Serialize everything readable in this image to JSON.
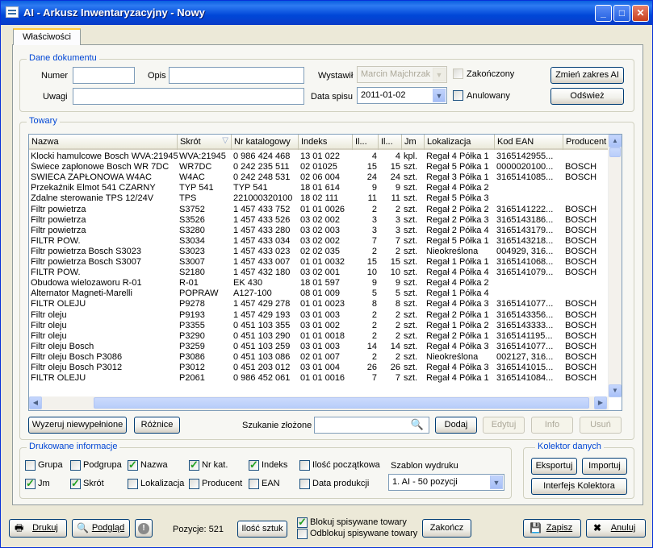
{
  "window": {
    "title": "AI - Arkusz Inwentaryzacyjny - Nowy",
    "min": "_",
    "max": "□",
    "close": "✕"
  },
  "tab": {
    "label": "Właściwości"
  },
  "doc": {
    "legend": "Dane dokumentu",
    "numer_label": "Numer",
    "numer_value": "",
    "opis_label": "Opis",
    "opis_value": "",
    "uwagi_label": "Uwagi",
    "uwagi_value": "",
    "wystawil_label": "Wystawił",
    "wystawil_value": "Marcin Majchrzak",
    "data_label": "Data spisu",
    "data_value": "2011-01-02",
    "zakonczony_label": "Zakończony",
    "anulowany_label": "Anulowany",
    "zmien_label": "Zmień zakres AI",
    "odswiez_label": "Odśwież"
  },
  "towary": {
    "legend": "Towary",
    "columns": [
      "Nazwa",
      "Skrót",
      "Nr katalogowy",
      "Indeks",
      "Il...",
      "Il...",
      "Jm",
      "Lokalizacja",
      "Kod EAN",
      "Producent"
    ],
    "rows": [
      [
        "Klocki hamulcowe Bosch WVA:21945",
        "WVA:21945",
        "0 986 424 468",
        "13 01 022",
        "4",
        "4",
        "kpl.",
        "Regał 4 Półka 1",
        "3165142955...",
        ""
      ],
      [
        "Świece zapłonowe Bosch WR 7DC",
        "WR7DC",
        "0 242 235 511",
        "02 01025",
        "15",
        "15",
        "szt.",
        "Regał 5 Półka 1",
        "0000020100...",
        "BOSCH"
      ],
      [
        "SWIECA ZAPŁONOWA  W4AC",
        "W4AC",
        "0 242 248 531",
        "02 06 004",
        "24",
        "24",
        "szt.",
        "Regał 3 Półka 1",
        "3165141085...",
        "BOSCH"
      ],
      [
        "Przekaźnik Elmot 541 CZARNY",
        "TYP 541",
        "TYP 541",
        "18 01 614",
        "9",
        "9",
        "szt.",
        "Regał 4 Półka 2",
        "",
        ""
      ],
      [
        "Zdalne sterowanie TPS 12/24V",
        "TPS",
        "221000320100",
        "18 02 111",
        "11",
        "11",
        "szt.",
        "Regał 5 Półka 3",
        "",
        ""
      ],
      [
        "Filtr powietrza",
        "S3752",
        "1 457 433 752",
        "01 01 0026",
        "2",
        "2",
        "szt.",
        "Regał 2 Półka 2",
        "3165141222...",
        "BOSCH"
      ],
      [
        "Filtr powietrza",
        "S3526",
        "1 457 433 526",
        "03 02 002",
        "3",
        "3",
        "szt.",
        "Regał 2 Półka 3",
        "3165143186...",
        "BOSCH"
      ],
      [
        "Filtr powietrza",
        "S3280",
        "1 457 433 280",
        "03 02 003",
        "3",
        "3",
        "szt.",
        "Regał 2 Półka 4",
        "3165143179...",
        "BOSCH"
      ],
      [
        "FILTR POW.",
        "S3034",
        "1 457 433 034",
        "03 02 002",
        "7",
        "7",
        "szt.",
        "Regał 5 Półka 1",
        "3165143218...",
        "BOSCH"
      ],
      [
        "Filtr powietrza Bosch S3023",
        "S3023",
        "1 457 433 023",
        "02 02 035",
        "2",
        "2",
        "szt.",
        "Nieokreślona",
        "004929, 316...",
        "BOSCH"
      ],
      [
        "Filtr powietrza Bosch S3007",
        "S3007",
        "1 457 433 007",
        "01 01 0032",
        "15",
        "15",
        "szt.",
        "Regał 1 Półka 1",
        "3165141068...",
        "BOSCH"
      ],
      [
        "FILTR POW.",
        "S2180",
        "1 457 432 180",
        "03 02 001",
        "10",
        "10",
        "szt.",
        "Regał 4 Półka 4",
        "3165141079...",
        "BOSCH"
      ],
      [
        "Obudowa wielozaworu R-01",
        "R-01",
        "EK 430",
        "18 01 597",
        "9",
        "9",
        "szt.",
        "Regał 4 Półka 2",
        "",
        ""
      ],
      [
        "Alternator Magneti-Marelli",
        "POPRAW",
        "A127-100",
        "08 01 009",
        "5",
        "5",
        "szt.",
        "Regał 1 Półka 4",
        "",
        ""
      ],
      [
        "FILTR OLEJU",
        "P9278",
        "1 457 429 278",
        "01 01 0023",
        "8",
        "8",
        "szt.",
        "Regał 4 Półka 3",
        "3165141077...",
        "BOSCH"
      ],
      [
        "Filtr oleju",
        "P9193",
        "1 457 429 193",
        "03 01 003",
        "2",
        "2",
        "szt.",
        "Regał 2 Półka 1",
        "3165143356...",
        "BOSCH"
      ],
      [
        "Filtr oleju",
        "P3355",
        "0 451 103 355",
        "03 01 002",
        "2",
        "2",
        "szt.",
        "Regał 1 Półka 2",
        "3165143333...",
        "BOSCH"
      ],
      [
        "Filtr oleju",
        "P3290",
        "0 451 103 290",
        "01 01 0018",
        "2",
        "2",
        "szt.",
        "Regał 2 Półka 1",
        "3165141195...",
        "BOSCH"
      ],
      [
        "Filtr oleju Bosch",
        "P3259",
        "0 451 103 259",
        "03 01 003",
        "14",
        "14",
        "szt.",
        "Regał 4 Półka 3",
        "3165141077...",
        "BOSCH"
      ],
      [
        "Filtr oleju Bosch P3086",
        "P3086",
        "0 451 103 086",
        "02 01 007",
        "2",
        "2",
        "szt.",
        "Nieokreślona",
        "002127, 316...",
        "BOSCH"
      ],
      [
        "Filtr oleju Bosch P3012",
        "P3012",
        "0 451 203 012",
        "03 01 004",
        "26",
        "26",
        "szt.",
        "Regał 4 Półka 3",
        "3165141015...",
        "BOSCH"
      ],
      [
        "FILTR OLEJU",
        "P2061",
        "0 986 452 061",
        "01 01 0016",
        "7",
        "7",
        "szt.",
        "Regał 4 Półka 1",
        "3165141084...",
        "BOSCH"
      ]
    ],
    "wyzeruj_label": "Wyzeruj niewypełnione",
    "roznice_label": "Różnice",
    "szukanie_label": "Szukanie złożone",
    "szukanie_value": "",
    "dodaj_label": "Dodaj",
    "edytuj_label": "Edytuj",
    "info_label": "Info",
    "usun_label": "Usuń"
  },
  "druk": {
    "legend": "Drukowane informacje",
    "items": [
      {
        "label": "Grupa",
        "checked": false
      },
      {
        "label": "Podgrupa",
        "checked": false
      },
      {
        "label": "Nazwa",
        "checked": true
      },
      {
        "label": "Nr kat.",
        "checked": true
      },
      {
        "label": "Indeks",
        "checked": true
      },
      {
        "label": "Ilość początkowa",
        "checked": false
      },
      {
        "label": "Jm",
        "checked": true
      },
      {
        "label": "Skrót",
        "checked": true
      },
      {
        "label": "Lokalizacja",
        "checked": false
      },
      {
        "label": "Producent",
        "checked": false
      },
      {
        "label": "EAN",
        "checked": false
      },
      {
        "label": "Data produkcji",
        "checked": false
      }
    ],
    "szablon_label": "Szablon wydruku",
    "szablon_value": "1. AI - 50 pozycji"
  },
  "kolektor": {
    "legend": "Kolektor danych",
    "eksportuj_label": "Eksportuj",
    "importuj_label": "Importuj",
    "interfejs_label": "Interfejs Kolektora"
  },
  "footer": {
    "drukuj_label": "Drukuj",
    "podglad_label": "Podgląd",
    "pozycje_label": "Pozycje: 521",
    "ilosc_label": "Ilość sztuk",
    "blokuj_label": "Blokuj spisywane towary",
    "odblokuj_label": "Odblokuj spisywane towary",
    "zakoncz_label": "Zakończ",
    "zapisz_label": "Zapisz",
    "anuluj_label": "Anuluj"
  }
}
